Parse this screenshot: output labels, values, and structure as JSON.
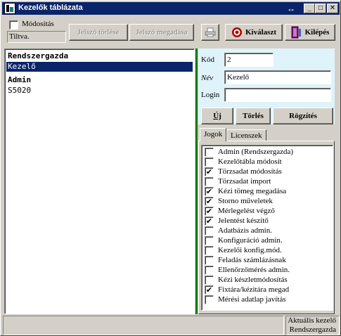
{
  "window": {
    "title": "Kezelők táblázata",
    "title_extra_glyph": "↔",
    "min_glyph": "_",
    "max_glyph": "□",
    "close_glyph": "✕"
  },
  "toolbar": {
    "modify_label": "Módosítás",
    "status_text": "Tiltva.",
    "clear_password": "Jelszó törlése",
    "set_password": "Jelszó megadása",
    "select_label": "Kiválaszt",
    "exit_label": "Kilépés",
    "print_icon": "printer-icon",
    "select_icon": "target-icon",
    "exit_icon": "door-exit-icon"
  },
  "user_list": {
    "items": [
      {
        "label": "Rendszergazda",
        "bold": true,
        "selected": false
      },
      {
        "label": "Kezelő",
        "bold": false,
        "selected": true
      },
      {
        "label": "Admin",
        "bold": true,
        "selected": false
      },
      {
        "label": "S5020",
        "bold": false,
        "selected": false
      }
    ]
  },
  "detail": {
    "code_label": "Kód",
    "code_value": "2",
    "name_label": "Név",
    "name_value": "Kezelő",
    "login_label": "Login",
    "login_value": "",
    "new_button": "Új",
    "delete_button": "Törlés",
    "save_button": "Rögzítés"
  },
  "tabs": [
    {
      "label": "Jogok",
      "active": true
    },
    {
      "label": "Licenszek",
      "active": false
    }
  ],
  "permissions": [
    {
      "label": "Admin (Rendszergazda)",
      "checked": false
    },
    {
      "label": "Kezelőtábla módosít",
      "checked": false
    },
    {
      "label": "Törzsadat módosítás",
      "checked": true
    },
    {
      "label": "Törzsadat import",
      "checked": false
    },
    {
      "label": "Kézi tömeg megadása",
      "checked": true
    },
    {
      "label": "Storno műveletek",
      "checked": true
    },
    {
      "label": "Mérlegelést végző",
      "checked": true
    },
    {
      "label": "Jelentést készítő",
      "checked": true
    },
    {
      "label": "Adatbázis admin.",
      "checked": false
    },
    {
      "label": "Konfiguráció admin.",
      "checked": false
    },
    {
      "label": "Kezelői konfig.mód.",
      "checked": false
    },
    {
      "label": "Feladás számlázásnak",
      "checked": false
    },
    {
      "label": "Ellenőrzőmérés admin.",
      "checked": false
    },
    {
      "label": "Kézi készletmódosítás",
      "checked": false
    },
    {
      "label": "Fixtára/kézitára megad",
      "checked": true
    },
    {
      "label": "Mérési adatlap javítás",
      "checked": false
    }
  ],
  "status_bar": {
    "line1": "Aktuális kezelő",
    "line2": "Rendszergazda"
  },
  "colors": {
    "title_bar": "#0a246a",
    "selection": "#0a246a",
    "detail_bg": "#dff3fb",
    "splitter": "#008000"
  }
}
